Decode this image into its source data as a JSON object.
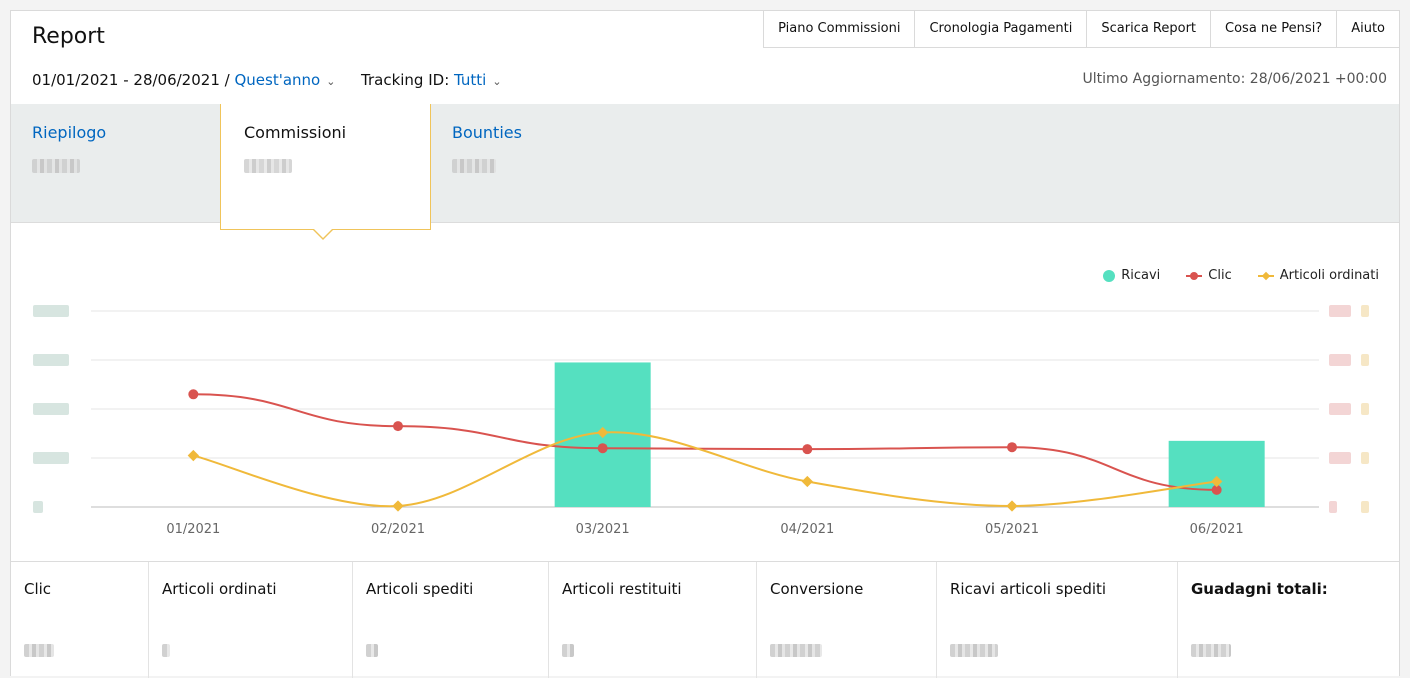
{
  "header": {
    "title": "Report",
    "links": [
      "Piano Commissioni",
      "Cronologia Pagamenti",
      "Scarica Report",
      "Cosa ne Pensi?",
      "Aiuto"
    ],
    "date_range": "01/01/2021 - 28/06/2021 /",
    "period": "Quest'anno",
    "tracking_label": "Tracking ID:",
    "tracking_value": "Tutti",
    "last_update": "Ultimo Aggiornamento: 28/06/2021 +00:00"
  },
  "summary": {
    "tabs": [
      "Riepilogo",
      "Commissioni",
      "Bounties"
    ],
    "active_tab": "Commissioni"
  },
  "chart_data": {
    "type": "bar",
    "categories": [
      "01/2021",
      "02/2021",
      "03/2021",
      "04/2021",
      "05/2021",
      "06/2021"
    ],
    "legend": [
      "Ricavi",
      "Clic",
      "Articoli ordinati"
    ],
    "legend_position": "top-right",
    "grid": true,
    "series": [
      {
        "name": "Ricavi",
        "kind": "bar",
        "axis": "left",
        "values": [
          0,
          0,
          2.95,
          0,
          0,
          1.35
        ],
        "color": "#55e0c0"
      },
      {
        "name": "Clic",
        "kind": "line",
        "axis": "right",
        "marker": "circle",
        "values": [
          2.3,
          1.65,
          1.2,
          1.18,
          1.22,
          0.35
        ],
        "color": "#d9534f"
      },
      {
        "name": "Articoli ordinati",
        "kind": "line",
        "axis": "right",
        "marker": "diamond",
        "smooth": true,
        "values": [
          1.05,
          0.02,
          1.52,
          0.52,
          0.02,
          0.52
        ],
        "color": "#f0b93a"
      }
    ],
    "ylim_left": [
      0,
      4
    ],
    "ylim_right": [
      0,
      4
    ],
    "note_axis_labels": "tick labels are blurred in the original"
  },
  "stats": {
    "labels": [
      "Clic",
      "Articoli ordinati",
      "Articoli spediti",
      "Articoli restituiti",
      "Conversione",
      "Ricavi articoli spediti",
      "Guadagni totali:"
    ]
  },
  "colors": {
    "link": "#0066c0",
    "bar": "#55e0c0",
    "clic": "#d9534f",
    "ordinati": "#f0b93a",
    "tab_border": "#f0c45a"
  }
}
